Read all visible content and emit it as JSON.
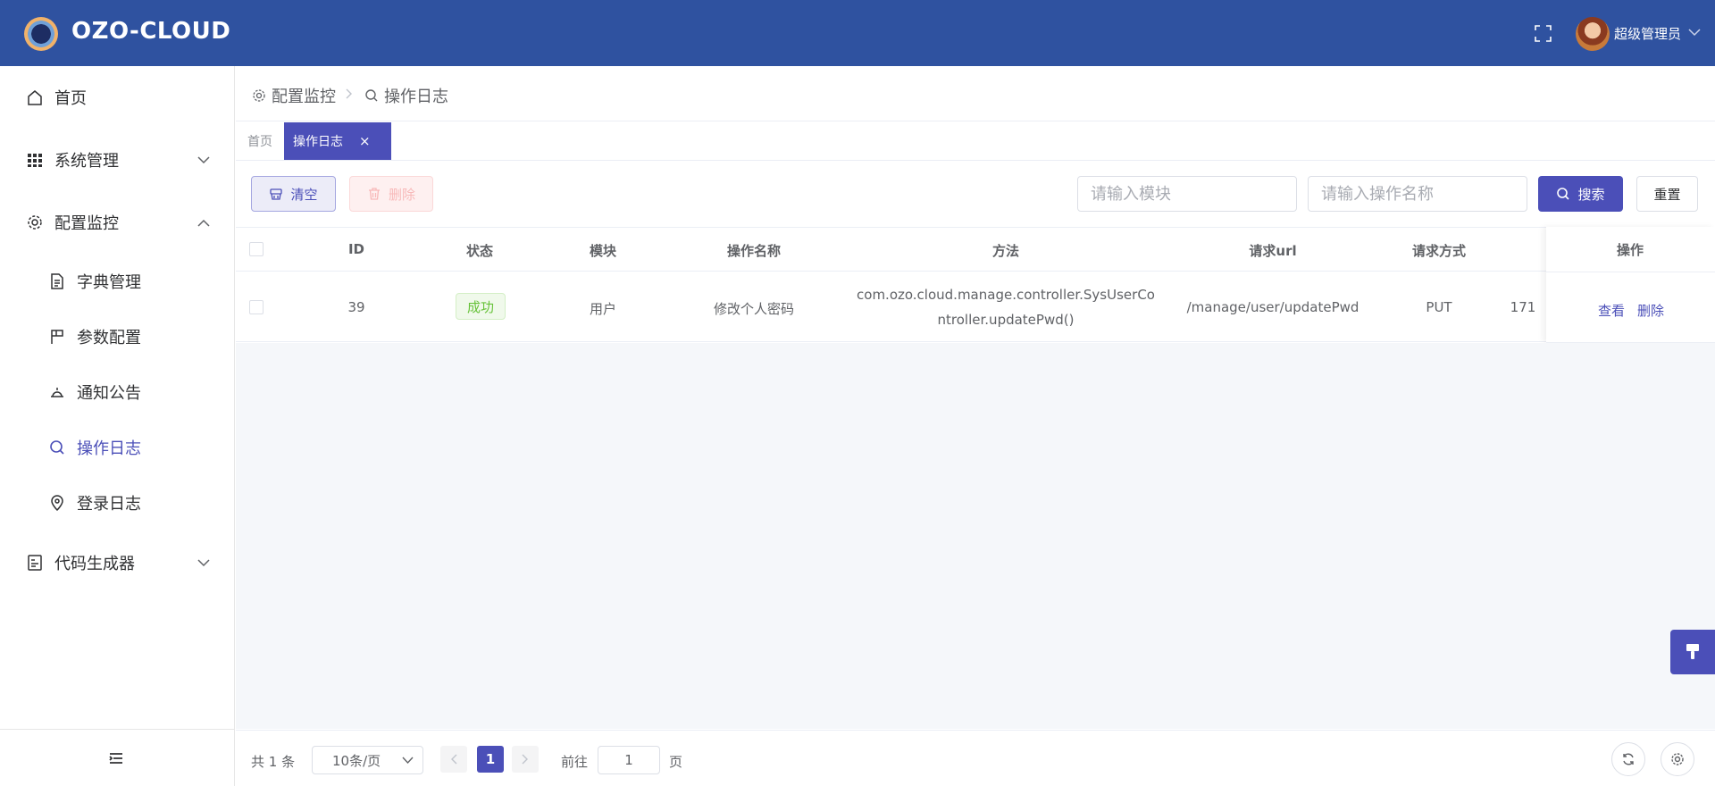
{
  "header": {
    "app_title": "OZO-CLOUD",
    "user_name": "超级管理员",
    "icons": [
      "logo-icon",
      "fullscreen-icon",
      "avatar",
      "chevron-down-icon"
    ]
  },
  "sidebar": {
    "items": [
      {
        "label": "首页",
        "icon": "home-icon"
      },
      {
        "label": "系统管理",
        "icon": "grid-icon",
        "expanded": false
      },
      {
        "label": "配置监控",
        "icon": "gear-icon",
        "expanded": true
      },
      {
        "label": "字典管理",
        "icon": "document-icon"
      },
      {
        "label": "参数配置",
        "icon": "flag-icon"
      },
      {
        "label": "通知公告",
        "icon": "bell-icon"
      },
      {
        "label": "操作日志",
        "icon": "search-icon",
        "active": true
      },
      {
        "label": "登录日志",
        "icon": "location-icon"
      },
      {
        "label": "代码生成器",
        "icon": "code-icon",
        "expanded": false
      }
    ]
  },
  "breadcrumb": {
    "items": [
      {
        "label": "配置监控",
        "icon": "gear-icon"
      },
      {
        "label": "操作日志",
        "icon": "search-icon"
      }
    ]
  },
  "tabs": [
    {
      "label": "首页"
    },
    {
      "label": "操作日志",
      "active": true,
      "close": "×"
    }
  ],
  "toolbar": {
    "clear_label": "清空",
    "delete_label": "删除",
    "module_placeholder": "请输入模块",
    "operation_placeholder": "请输入操作名称",
    "search_label": "搜索",
    "reset_label": "重置"
  },
  "table": {
    "columns": [
      "ID",
      "状态",
      "模块",
      "操作名称",
      "方法",
      "请求url",
      "请求方式",
      "操作"
    ],
    "rows": [
      {
        "id": "39",
        "status": "成功",
        "module": "用户",
        "operation": "修改个人密码",
        "method": "com.ozo.cloud.manage.controller.SysUserController.updatePwd()",
        "url": "/manage/user/updatePwd",
        "request_method": "PUT",
        "truncated_cell": "171",
        "actions": [
          "查看",
          "删除"
        ]
      }
    ]
  },
  "pagination": {
    "total": "共 1 条",
    "page_size": "10条/页",
    "current_page": "1",
    "goto_label": "前往",
    "goto_value": "1",
    "page_suffix": "页"
  },
  "colors": {
    "header_bg": "#2f52a0",
    "accent": "#4b4fb8",
    "success": "#67c23a",
    "danger_light": "#f8b9b9"
  }
}
